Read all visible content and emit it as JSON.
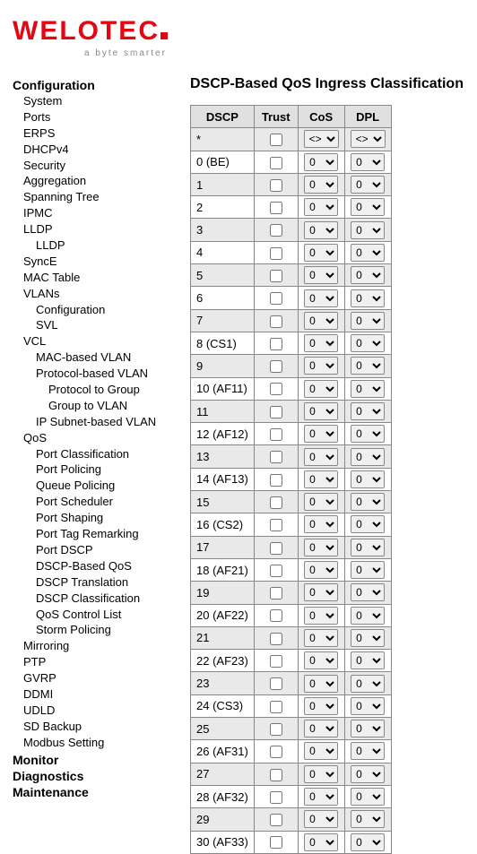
{
  "brand": {
    "name": "WELOTEC",
    "tagline": "a byte smarter"
  },
  "nav": {
    "sections": [
      {
        "label": "Configuration",
        "items": [
          {
            "label": "System",
            "level": 1
          },
          {
            "label": "Ports",
            "level": 1
          },
          {
            "label": "ERPS",
            "level": 1
          },
          {
            "label": "DHCPv4",
            "level": 1
          },
          {
            "label": "Security",
            "level": 1
          },
          {
            "label": "Aggregation",
            "level": 1
          },
          {
            "label": "Spanning Tree",
            "level": 1
          },
          {
            "label": "IPMC",
            "level": 1
          },
          {
            "label": "LLDP",
            "level": 1
          },
          {
            "label": "LLDP",
            "level": 2
          },
          {
            "label": "SyncE",
            "level": 1
          },
          {
            "label": "MAC Table",
            "level": 1
          },
          {
            "label": "VLANs",
            "level": 1
          },
          {
            "label": "Configuration",
            "level": 2
          },
          {
            "label": "SVL",
            "level": 2
          },
          {
            "label": "VCL",
            "level": 1
          },
          {
            "label": "MAC-based VLAN",
            "level": 2
          },
          {
            "label": "Protocol-based VLAN",
            "level": 2
          },
          {
            "label": "Protocol to Group",
            "level": 3
          },
          {
            "label": "Group to VLAN",
            "level": 3
          },
          {
            "label": "IP Subnet-based VLAN",
            "level": 2
          },
          {
            "label": "QoS",
            "level": 1
          },
          {
            "label": "Port Classification",
            "level": 2
          },
          {
            "label": "Port Policing",
            "level": 2
          },
          {
            "label": "Queue Policing",
            "level": 2
          },
          {
            "label": "Port Scheduler",
            "level": 2
          },
          {
            "label": "Port Shaping",
            "level": 2
          },
          {
            "label": "Port Tag Remarking",
            "level": 2
          },
          {
            "label": "Port DSCP",
            "level": 2
          },
          {
            "label": "DSCP-Based QoS",
            "level": 2
          },
          {
            "label": "DSCP Translation",
            "level": 2
          },
          {
            "label": "DSCP Classification",
            "level": 2
          },
          {
            "label": "QoS Control List",
            "level": 2
          },
          {
            "label": "Storm Policing",
            "level": 2
          },
          {
            "label": "Mirroring",
            "level": 1
          },
          {
            "label": "PTP",
            "level": 1
          },
          {
            "label": "GVRP",
            "level": 1
          },
          {
            "label": "DDMI",
            "level": 1
          },
          {
            "label": "UDLD",
            "level": 1
          },
          {
            "label": "SD Backup",
            "level": 1
          },
          {
            "label": "Modbus Setting",
            "level": 1
          }
        ]
      },
      {
        "label": "Monitor",
        "items": []
      },
      {
        "label": "Diagnostics",
        "items": []
      },
      {
        "label": "Maintenance",
        "items": []
      }
    ]
  },
  "page": {
    "title": "DSCP-Based QoS Ingress Classification",
    "columns": {
      "dscp": "DSCP",
      "trust": "Trust",
      "cos": "CoS",
      "dpl": "DPL"
    },
    "first_row": {
      "dscp": "*",
      "cos": "<>",
      "dpl": "<>"
    },
    "rows": [
      {
        "dscp": "0 (BE)",
        "cos": "0",
        "dpl": "0"
      },
      {
        "dscp": "1",
        "cos": "0",
        "dpl": "0"
      },
      {
        "dscp": "2",
        "cos": "0",
        "dpl": "0"
      },
      {
        "dscp": "3",
        "cos": "0",
        "dpl": "0"
      },
      {
        "dscp": "4",
        "cos": "0",
        "dpl": "0"
      },
      {
        "dscp": "5",
        "cos": "0",
        "dpl": "0"
      },
      {
        "dscp": "6",
        "cos": "0",
        "dpl": "0"
      },
      {
        "dscp": "7",
        "cos": "0",
        "dpl": "0"
      },
      {
        "dscp": "8 (CS1)",
        "cos": "0",
        "dpl": "0"
      },
      {
        "dscp": "9",
        "cos": "0",
        "dpl": "0"
      },
      {
        "dscp": "10 (AF11)",
        "cos": "0",
        "dpl": "0"
      },
      {
        "dscp": "11",
        "cos": "0",
        "dpl": "0"
      },
      {
        "dscp": "12 (AF12)",
        "cos": "0",
        "dpl": "0"
      },
      {
        "dscp": "13",
        "cos": "0",
        "dpl": "0"
      },
      {
        "dscp": "14 (AF13)",
        "cos": "0",
        "dpl": "0"
      },
      {
        "dscp": "15",
        "cos": "0",
        "dpl": "0"
      },
      {
        "dscp": "16 (CS2)",
        "cos": "0",
        "dpl": "0"
      },
      {
        "dscp": "17",
        "cos": "0",
        "dpl": "0"
      },
      {
        "dscp": "18 (AF21)",
        "cos": "0",
        "dpl": "0"
      },
      {
        "dscp": "19",
        "cos": "0",
        "dpl": "0"
      },
      {
        "dscp": "20 (AF22)",
        "cos": "0",
        "dpl": "0"
      },
      {
        "dscp": "21",
        "cos": "0",
        "dpl": "0"
      },
      {
        "dscp": "22 (AF23)",
        "cos": "0",
        "dpl": "0"
      },
      {
        "dscp": "23",
        "cos": "0",
        "dpl": "0"
      },
      {
        "dscp": "24 (CS3)",
        "cos": "0",
        "dpl": "0"
      },
      {
        "dscp": "25",
        "cos": "0",
        "dpl": "0"
      },
      {
        "dscp": "26 (AF31)",
        "cos": "0",
        "dpl": "0"
      },
      {
        "dscp": "27",
        "cos": "0",
        "dpl": "0"
      },
      {
        "dscp": "28 (AF32)",
        "cos": "0",
        "dpl": "0"
      },
      {
        "dscp": "29",
        "cos": "0",
        "dpl": "0"
      },
      {
        "dscp": "30 (AF33)",
        "cos": "0",
        "dpl": "0"
      }
    ]
  }
}
